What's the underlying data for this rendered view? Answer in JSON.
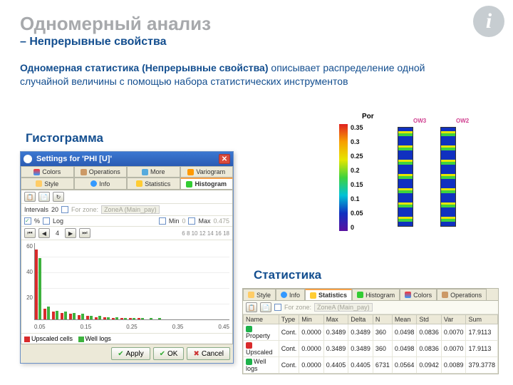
{
  "slide": {
    "title": "Одномерный анализ",
    "subtitle": "– Непрерывные свойства",
    "descBold": "Одномерная статистика (Непрерывные свойства)",
    "descRest": " описывает распределение одной случайной величины с помощью набора статистических инструментов",
    "label1": "Гистограмма",
    "label2": "Статистика"
  },
  "settings": {
    "winTitle": "Settings for 'PHI [U]'",
    "tabsTop": [
      "Colors",
      "Operations",
      "More",
      "Variogram"
    ],
    "tabsBottom": [
      "Style",
      "Info",
      "Statistics",
      "Histogram"
    ],
    "activeTab": "Histogram",
    "intervals": {
      "label": "Intervals",
      "value": "20"
    },
    "forZone": {
      "label": "For zone:",
      "value": "ZoneA (Main_pay)"
    },
    "pctLabel": "%",
    "logLabel": "Log",
    "minLabel": "Min",
    "minVal": "0",
    "maxLabel": "Max",
    "maxVal": "0.475",
    "yTicks": [
      "60",
      "40",
      "20"
    ],
    "xTicks": [
      "0.05",
      "0.15",
      "0.25",
      "0.35",
      "0.45"
    ],
    "legend": {
      "u": "Upscaled cells",
      "w": "Well logs"
    },
    "btnApply": "Apply",
    "btnOK": "OK",
    "btnCancel": "Cancel"
  },
  "viz": {
    "title": "Por",
    "ticks": [
      "0.35",
      "0.3",
      "0.25",
      "0.2",
      "0.15",
      "0.1",
      "0.05",
      "0"
    ],
    "well1": "OW3",
    "well2": "OW2"
  },
  "stat": {
    "tabs": [
      "Style",
      "Info",
      "Statistics",
      "Histogram",
      "Colors",
      "Operations"
    ],
    "activeTab": "Statistics",
    "forZoneLabel": "For zone:",
    "forZoneVal": "ZoneA (Main_pay)",
    "headers": [
      "Name",
      "Type",
      "Min",
      "Max",
      "Delta",
      "N",
      "Mean",
      "Std",
      "Var",
      "Sum"
    ],
    "rows": [
      {
        "ico": "#1eb24a",
        "cells": [
          "Property",
          "Cont.",
          "0.0000",
          "0.3489",
          "0.3489",
          "360",
          "0.0498",
          "0.0836",
          "0.0070",
          "17.9113"
        ]
      },
      {
        "ico": "#d92b2b",
        "cells": [
          "Upscaled",
          "Cont.",
          "0.0000",
          "0.3489",
          "0.3489",
          "360",
          "0.0498",
          "0.0836",
          "0.0070",
          "17.9113"
        ]
      },
      {
        "ico": "#1eb24a",
        "cells": [
          "Well logs",
          "Cont.",
          "0.0000",
          "0.4405",
          "0.4405",
          "6731",
          "0.0564",
          "0.0942",
          "0.0089",
          "379.3778"
        ]
      }
    ]
  },
  "chart_data": {
    "type": "bar",
    "title": "PHI [U] histogram",
    "xlabel": "",
    "ylabel": "%",
    "ylim": [
      0,
      70
    ],
    "xlim": [
      0,
      0.475
    ],
    "categories": [
      0.025,
      0.05,
      0.075,
      0.1,
      0.125,
      0.15,
      0.175,
      0.2,
      0.225,
      0.25,
      0.275,
      0.3,
      0.325,
      0.35,
      0.375,
      0.4,
      0.425,
      0.45
    ],
    "series": [
      {
        "name": "Upscaled cells",
        "color": "#d92b2b",
        "values": [
          64,
          10,
          7,
          6,
          5,
          4,
          3,
          2,
          2,
          1,
          1,
          1,
          1,
          0,
          0,
          0,
          0,
          0
        ]
      },
      {
        "name": "Well logs",
        "color": "#3eb23e",
        "values": [
          56,
          12,
          8,
          7,
          6,
          5,
          3,
          3,
          2,
          2,
          1,
          1,
          1,
          1,
          1,
          0,
          0,
          0
        ]
      }
    ]
  }
}
